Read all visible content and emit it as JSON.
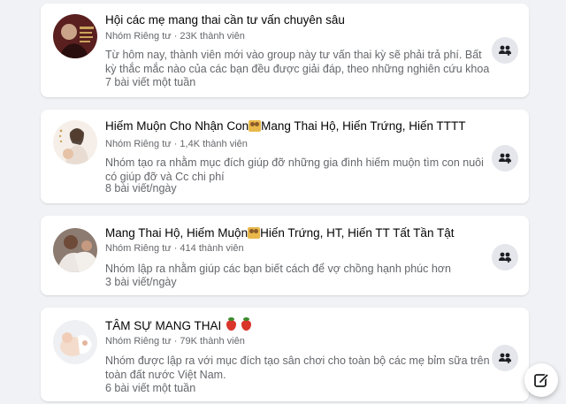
{
  "groups": [
    {
      "name": "Hội các mẹ mang thai cần tư vấn chuyên sâu",
      "privacy": "Nhóm Riêng tư",
      "members": "23K thành viên",
      "description": "Từ hôm nay, thành viên mới vào group này tư vấn thai kỳ sẽ phải trả phí. Bất kỳ thắc mắc nào của các bạn đều được giải đáp, theo những nghiên cứu khoa h...",
      "frequency": "7 bài viết một tuần"
    },
    {
      "name_part1": "Hiếm Muộn Cho Nhận Con",
      "name_part2": "Mang Thai Hộ, Hiến Trứng, Hiến TTTT",
      "privacy": "Nhóm Riêng tư",
      "members": "1,4K thành viên",
      "description": "Nhóm tạo ra nhằm mục đích giúp đỡ những gia đình hiếm muộn tìm con nuôi có giúp đỡ và Cc chi phí",
      "frequency": "8 bài viết/ngày"
    },
    {
      "name_part1": "Mang Thai Hộ, Hiếm Muộn",
      "name_part2": "Hiến Trứng, HT, Hiến TT Tất Tần Tật",
      "privacy": "Nhóm Riêng tư",
      "members": "414 thành viên",
      "description": "Nhóm lập ra nhằm giúp các bạn biết cách để vợ chồng hạnh phúc hơn",
      "frequency": "3 bài viết/ngày"
    },
    {
      "name": "TÂM SỰ MANG THAI",
      "privacy": "Nhóm Riêng tư",
      "members": "79K thành viên",
      "description": "Nhóm được lập ra với mục đích tạo sân chơi cho toàn bộ các mẹ bỉm sữa trên toàn đất nước Việt Nam.",
      "frequency": "6 bài viết một tuần"
    }
  ],
  "separator": "·",
  "icons": {
    "join": "group-join-icon",
    "compose": "compose-icon",
    "group_emoji": "family-emoji-icon",
    "strawberry": "strawberry-emoji-icon"
  },
  "colors": {
    "background": "#f0f2f5",
    "card": "#ffffff",
    "primary_text": "#050505",
    "secondary_text": "#65676b",
    "icon_button": "#e4e6eb"
  }
}
